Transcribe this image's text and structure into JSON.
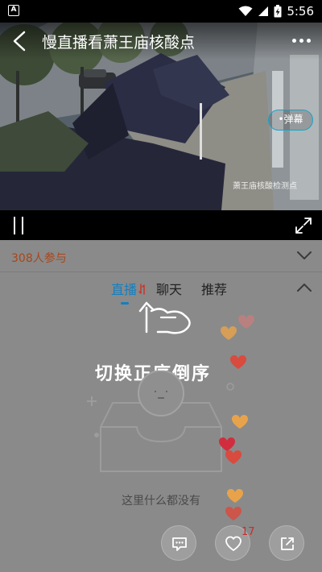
{
  "status_bar": {
    "app_badge": "A",
    "time": "5:56",
    "icons": [
      "wifi-icon",
      "signal-icon",
      "battery-charging-icon"
    ]
  },
  "player": {
    "title": "慢直播看萧王庙核酸点",
    "danmu_label": "•弹幕",
    "watermark": "萧王庙核酸检测点",
    "icons": [
      "back-icon",
      "more-icon",
      "pause-icon",
      "fullscreen-icon"
    ]
  },
  "participants": {
    "count_label": "308人参与",
    "accent_color": "#a8461c"
  },
  "tabs": {
    "items": [
      {
        "label": "直播",
        "active": true
      },
      {
        "label": "聊天",
        "active": false
      },
      {
        "label": "推荐",
        "active": false
      }
    ],
    "active_color": "#137fc0"
  },
  "hint": {
    "text": "切换正序倒序"
  },
  "empty_state": {
    "text": "这里什么都没有"
  },
  "actions": {
    "like_count": "17",
    "icons": [
      "comment-icon",
      "heart-icon",
      "share-icon"
    ]
  }
}
